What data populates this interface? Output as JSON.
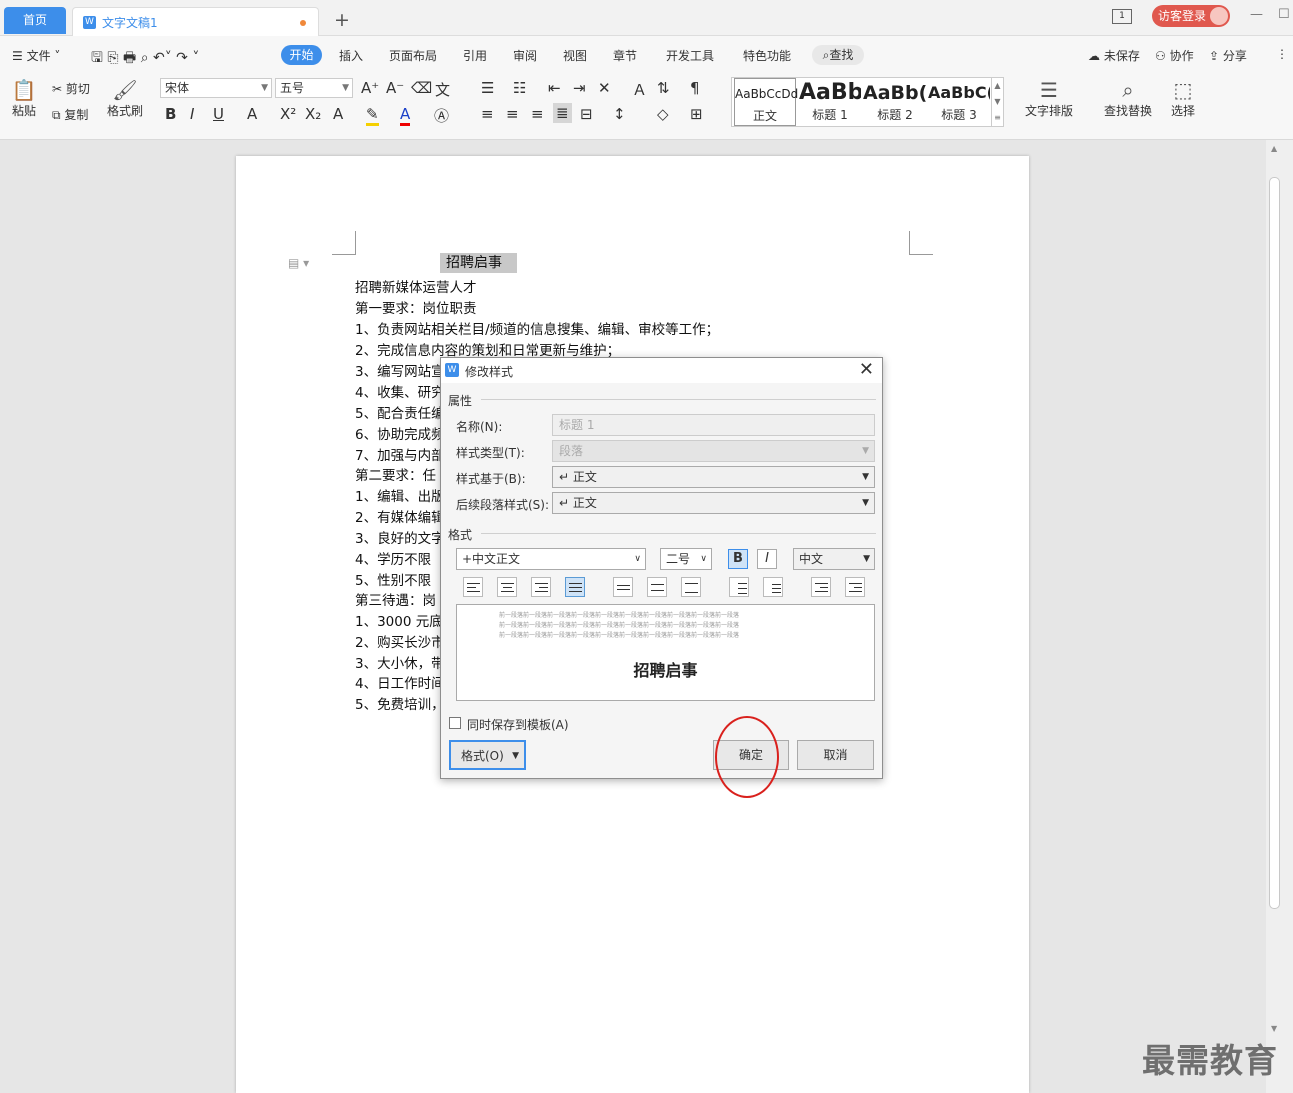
{
  "tabs": {
    "home": "首页",
    "doc": "文字文稿1",
    "new": "+"
  },
  "titlebar": {
    "login": "访客登录",
    "page_indicator": "1"
  },
  "menu": {
    "file": "文件",
    "items": [
      "开始",
      "插入",
      "页面布局",
      "引用",
      "审阅",
      "视图",
      "章节",
      "开发工具",
      "特色功能"
    ],
    "search": "查找",
    "unsaved": "未保存",
    "collab": "协作",
    "share": "分享"
  },
  "ribbon": {
    "paste": "粘贴",
    "cut": "剪切",
    "copy": "复制",
    "format_painter": "格式刷",
    "font": "宋体",
    "size": "五号",
    "styles": [
      {
        "preview": "AaBbCcDd",
        "label": "正文"
      },
      {
        "preview": "AaBb",
        "label": "标题 1"
      },
      {
        "preview": "AaBb(",
        "label": "标题 2"
      },
      {
        "preview": "AaBbC(",
        "label": "标题 3"
      }
    ],
    "text_layout": "文字排版",
    "find_replace": "查找替换",
    "select": "选择"
  },
  "document": {
    "title": "招聘启事",
    "lines": [
      "招聘新媒体运营人才",
      "第一要求：岗位职责",
      "1、负责网站相关栏目/频道的信息搜集、编辑、审校等工作；",
      "2、完成信息内容的策划和日常更新与维护；",
      "3、编写网站宣",
      "4、收集、研究",
      "5、配合责任编",
      "6、协助完成频",
      "7、加强与内部",
      "第二要求：任",
      "1、编辑、出版",
      "2、有媒体编辑",
      "3、良好的文字",
      "4、学历不限",
      "5、性别不限",
      "第三待遇：岗",
      "1、3000 元底薪",
      "2、购买长沙市",
      "3、大小休，带",
      "4、日工作时间",
      "5、免费培训，"
    ]
  },
  "dialog": {
    "title": "修改样式",
    "group_props": "属性",
    "name_label": "名称(N):",
    "name_value": "标题 1",
    "type_label": "样式类型(T):",
    "type_value": "段落",
    "based_label": "样式基于(B):",
    "based_value": "↵ 正文",
    "next_label": "后续段落样式(S):",
    "next_value": "↵ 正文",
    "group_format": "格式",
    "font": "+中文正文",
    "size": "二号",
    "bold": "B",
    "italic": "I",
    "lang": "中文",
    "preview_filler": "前一段落前一段落前一段落前一段落前一段落前一段落前一段落前一段落前一段落前一段落",
    "preview_title": "招聘启事",
    "save_template": "同时保存到模板(A)",
    "format_btn": "格式(O)",
    "ok": "确定",
    "cancel": "取消"
  },
  "watermark": "最需教育"
}
